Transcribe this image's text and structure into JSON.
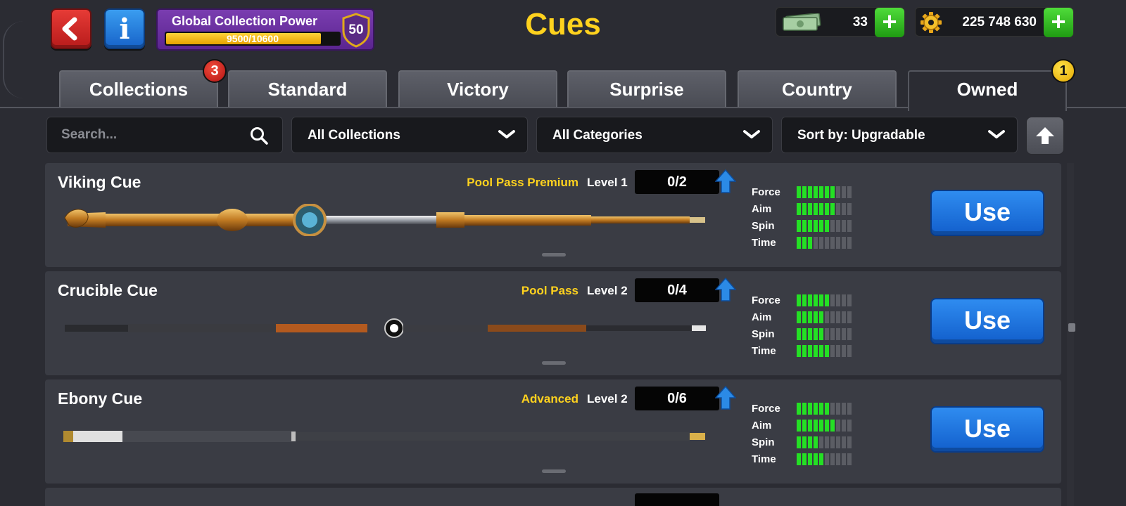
{
  "header": {
    "title": "Cues",
    "global_power": {
      "label": "Global Collection Power",
      "progress_text": "9500/10600",
      "progress_fraction": 0.896,
      "level": "50"
    },
    "cash": "33",
    "coins": "225 748 630"
  },
  "tabs": [
    {
      "label": "Collections",
      "badge": "3",
      "badge_color": "#c21a1a"
    },
    {
      "label": "Standard"
    },
    {
      "label": "Victory"
    },
    {
      "label": "Surprise"
    },
    {
      "label": "Country"
    },
    {
      "label": "Owned",
      "badge": "1",
      "badge_color": "#f2c20a",
      "active": true
    }
  ],
  "filters": {
    "search_placeholder": "Search...",
    "collections": "All Collections",
    "categories": "All Categories",
    "sort": "Sort by: Upgradable"
  },
  "cues": [
    {
      "name": "Viking Cue",
      "rarity": "Pool Pass Premium",
      "level": "Level 1",
      "progress": "0/2",
      "stats": [
        {
          "label": "Force",
          "value": 7
        },
        {
          "label": "Aim",
          "value": 7
        },
        {
          "label": "Spin",
          "value": 6
        },
        {
          "label": "Time",
          "value": 3
        }
      ],
      "use_label": "Use",
      "style": "viking"
    },
    {
      "name": "Crucible Cue",
      "rarity": "Pool Pass",
      "level": "Level 2",
      "progress": "0/4",
      "stats": [
        {
          "label": "Force",
          "value": 6
        },
        {
          "label": "Aim",
          "value": 5
        },
        {
          "label": "Spin",
          "value": 5
        },
        {
          "label": "Time",
          "value": 6
        }
      ],
      "use_label": "Use",
      "style": "crucible"
    },
    {
      "name": "Ebony Cue",
      "rarity": "Advanced",
      "level": "Level 2",
      "progress": "0/6",
      "stats": [
        {
          "label": "Force",
          "value": 6
        },
        {
          "label": "Aim",
          "value": 7
        },
        {
          "label": "Spin",
          "value": 4
        },
        {
          "label": "Time",
          "value": 5
        }
      ],
      "use_label": "Use",
      "style": "ebony"
    }
  ],
  "colors": {
    "accent_yellow": "#ffd21e",
    "stat_on": "#24e024",
    "use_blue": "#1a72dd",
    "back_red": "#d12b28",
    "info_blue": "#2880de",
    "plus_green": "#32b820"
  },
  "icons": [
    "back-arrow-icon",
    "info-icon",
    "shield-icon",
    "cash-icon",
    "coin-gear-icon",
    "plus-icon",
    "search-icon",
    "chevron-down-icon",
    "arrow-up-icon",
    "upgrade-arrow-icon"
  ]
}
